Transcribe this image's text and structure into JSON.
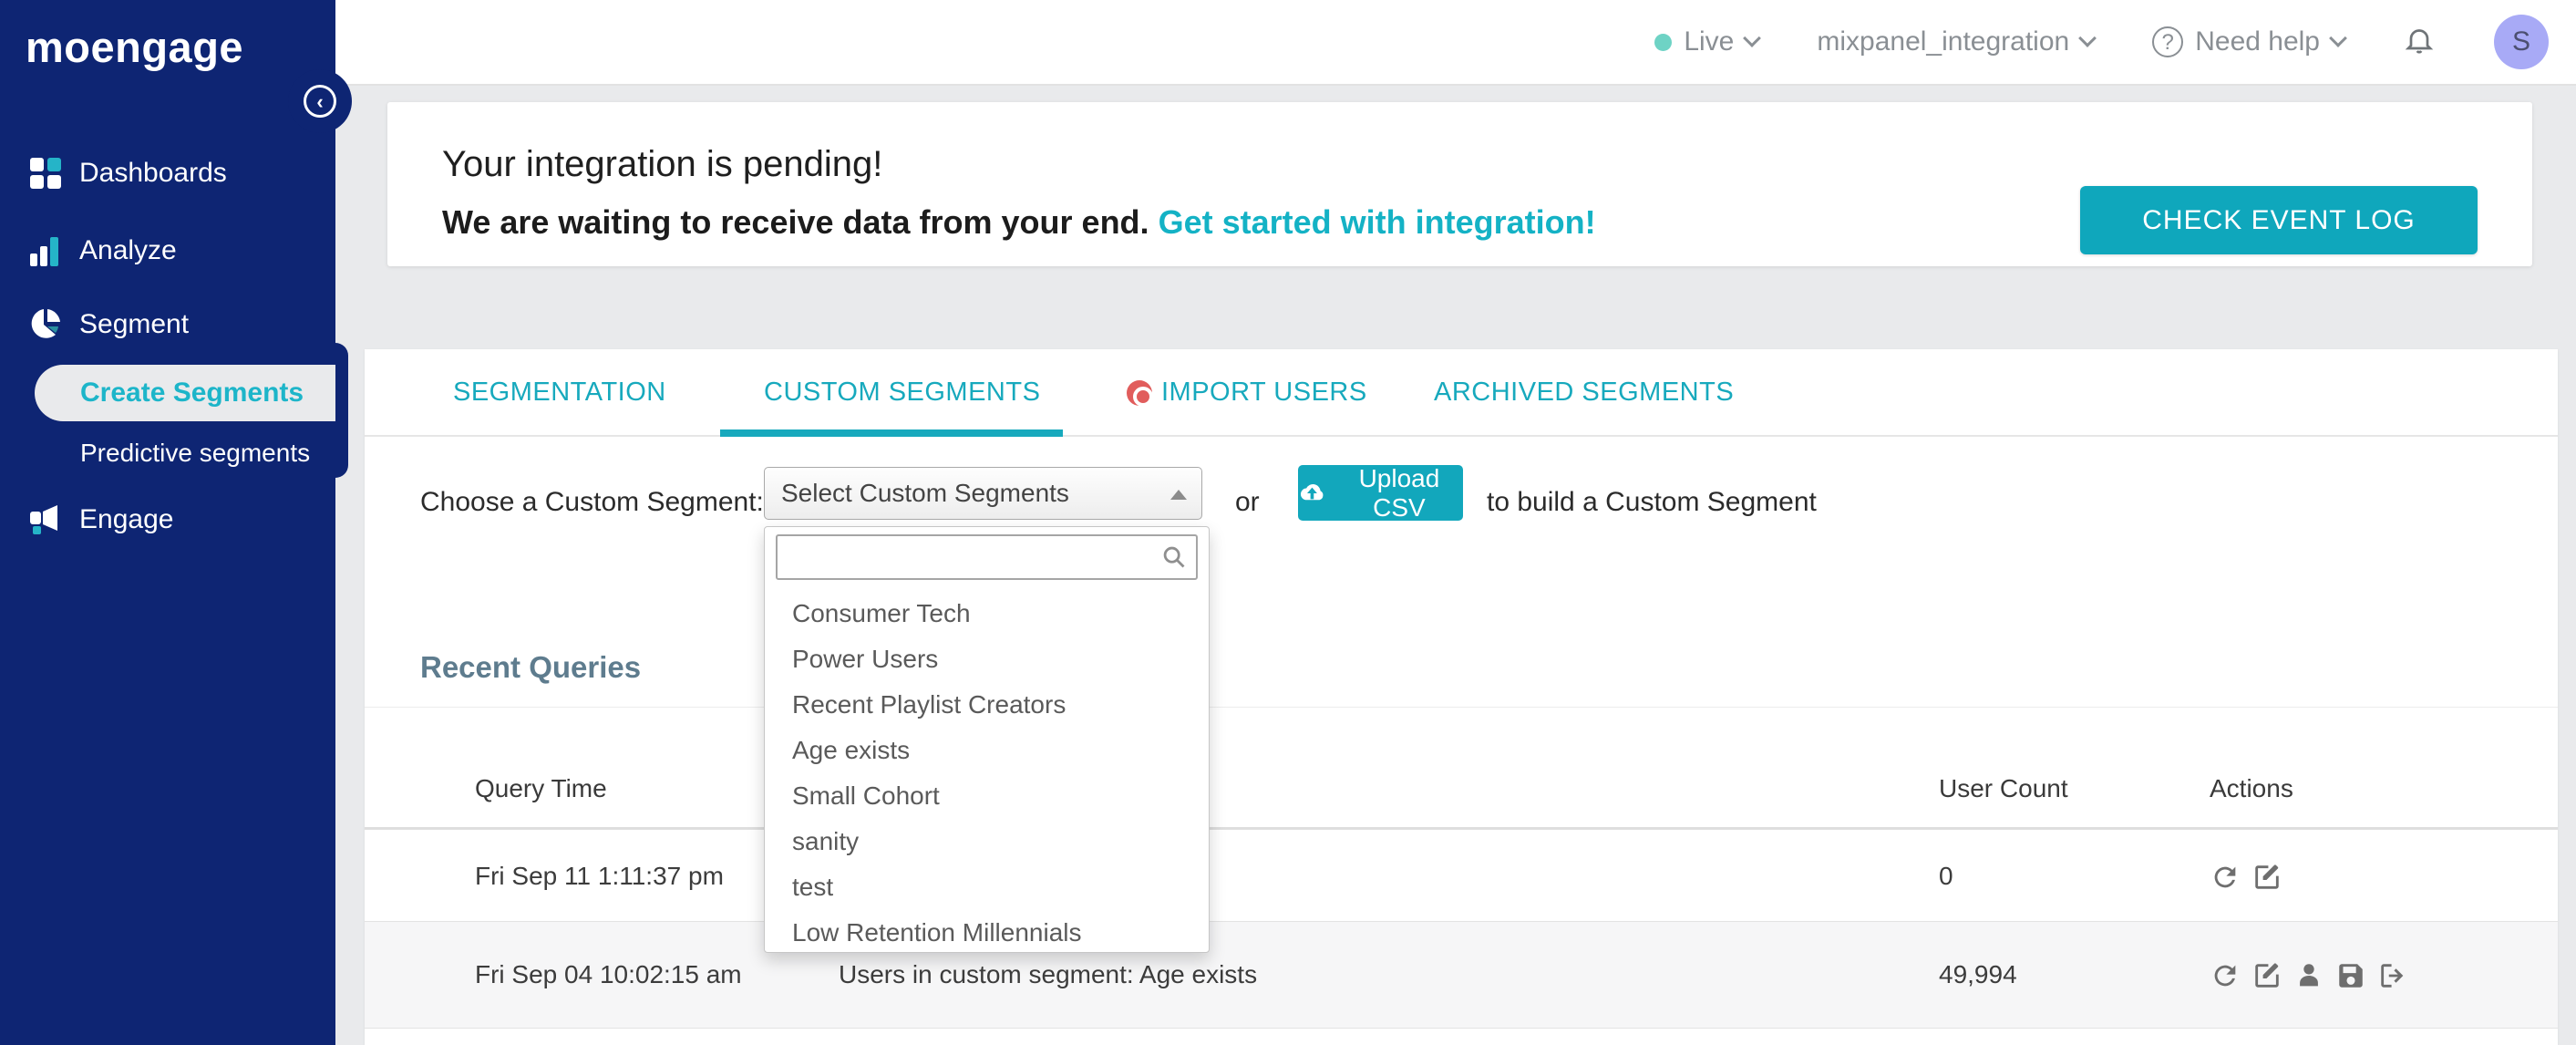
{
  "sidebar": {
    "logo_text": "moengage",
    "items": [
      {
        "label": "Dashboards",
        "icon": "grid-icon"
      },
      {
        "label": "Analyze",
        "icon": "bar-chart-icon"
      },
      {
        "label": "Segment",
        "icon": "pie-chart-icon"
      },
      {
        "label": "Engage",
        "icon": "megaphone-icon"
      }
    ],
    "segment_subitems": [
      {
        "label": "Create Segments",
        "active": true
      },
      {
        "label": "Predictive segments",
        "active": false
      }
    ]
  },
  "topbar": {
    "env_label": "Live",
    "workspace": "mixpanel_integration",
    "help_label": "Need help",
    "avatar_initial": "S"
  },
  "banner": {
    "title": "Your integration is pending!",
    "subtitle": "We are waiting to receive data from your end.",
    "link_text": "Get started with integration!",
    "button_label": "CHECK EVENT LOG"
  },
  "tabs": [
    {
      "label": "SEGMENTATION",
      "active": false
    },
    {
      "label": "CUSTOM SEGMENTS",
      "active": true
    },
    {
      "label": "IMPORT USERS",
      "active": false,
      "icon": "record-dot-icon"
    },
    {
      "label": "ARCHIVED SEGMENTS",
      "active": false
    }
  ],
  "segment_picker": {
    "label": "Choose a Custom Segment:",
    "select_value": "Select Custom Segments",
    "or_text": "or",
    "upload_button_label": "Upload CSV",
    "suffix_text": "to build a Custom Segment",
    "dropdown": {
      "search_value": "",
      "options": [
        "Consumer Tech",
        "Power Users",
        "Recent Playlist Creators",
        "Age exists",
        "Small Cohort",
        "sanity",
        "test",
        "Low Retention Millennials"
      ]
    }
  },
  "recent_queries": {
    "title": "Recent Queries",
    "columns": {
      "query_time": "Query Time",
      "user_count": "User Count",
      "actions": "Actions"
    },
    "rows": [
      {
        "query_time": "Fri Sep 11 1:11:37 pm",
        "description": "",
        "user_count": "0",
        "actions": [
          "refresh",
          "edit"
        ]
      },
      {
        "query_time": "Fri Sep 04 10:02:15 am",
        "description": "Users in custom segment: Age exists",
        "user_count": "49,994",
        "actions": [
          "refresh",
          "edit",
          "user",
          "save",
          "export"
        ]
      }
    ]
  },
  "colors": {
    "sidebar_navy": "#0e2573",
    "teal_accent": "#12a7bc",
    "link_teal": "#14b2c5",
    "live_dot": "#6ed3c5",
    "avatar_bg": "#a8aaf6",
    "import_red": "#e15d5c",
    "heading_slate": "#5e7c8e"
  }
}
